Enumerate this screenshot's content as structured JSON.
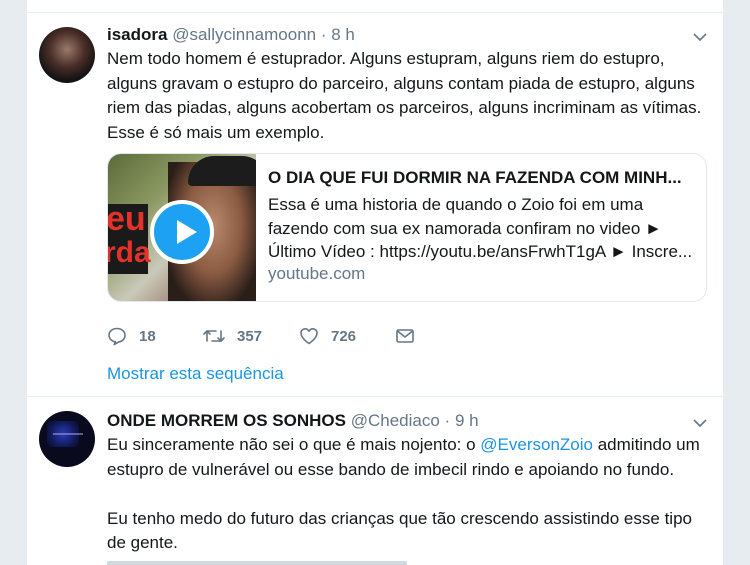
{
  "tweets": [
    {
      "name": "isadora",
      "handle": "@sallycinnamoonn",
      "time_sep": "·",
      "time": "8 h",
      "text_lines": [
        "Nem todo homem é estuprador. Alguns estupram, alguns riem do estupro,",
        "alguns gravam o estupro do parceiro, alguns contam piada de estupro, alguns",
        "riem das piadas, alguns acobertam os parceiros, alguns incriminam as vítimas.",
        "Esse é só mais um exemplo."
      ],
      "card": {
        "thumb_text_1": "eu",
        "thumb_text_2": "rda",
        "title": "O DIA QUE FUI DORMIR NA FAZENDA COM MINH...",
        "desc_lines": [
          "Essa é uma historia de quando o Zoio foi em uma",
          "fazendo com sua ex namorada confiram no video ►",
          "Último Vídeo : https://youtu.be/ansFrwhT1gA ► Inscre..."
        ],
        "domain": "youtube.com"
      },
      "actions": {
        "replies": "18",
        "retweets": "357",
        "likes": "726"
      },
      "show_thread": "Mostrar esta sequência"
    },
    {
      "name": "ONDE MORREM OS SONHOS",
      "handle": "@Chediaco",
      "time_sep": "·",
      "time": "9 h",
      "text_pre": "Eu sinceramente não sei o que é mais nojento: o ",
      "mention": "@EversonZoio",
      "text_post": " admitindo um",
      "text_line2": "estupro de vulnerável ou esse bando de imbecil rindo e apoiando no fundo.",
      "text_line3": "Eu tenho medo do futuro das crianças que tão crescendo assistindo esse tipo",
      "text_line4": "de gente."
    }
  ],
  "colors": {
    "accent": "#1da1f2",
    "link": "#1b95e0",
    "muted": "#657786",
    "text": "#14171a",
    "background": "#e6ecf0"
  }
}
